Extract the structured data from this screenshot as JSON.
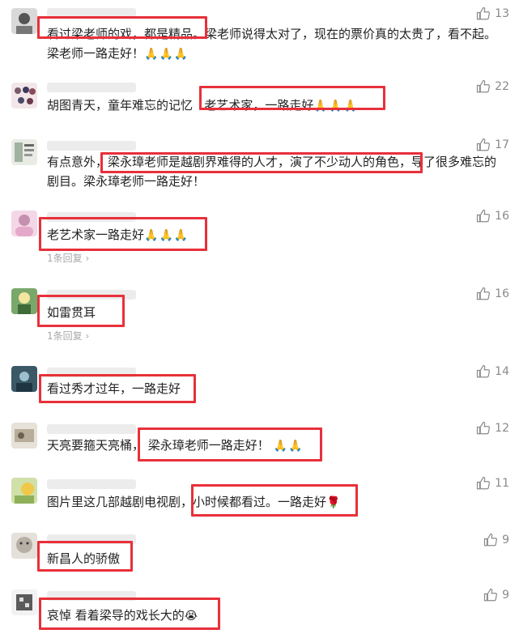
{
  "comments": [
    {
      "likes": "13",
      "text": "看过梁老师的戏，都是精品。梁老师说得太对了，现在的票价真的太贵了，看不起。梁老师一路走好！",
      "emoji": "🙏🙏🙏"
    },
    {
      "likes": "22",
      "text_a": "胡图青天，童年难忘的记忆",
      "text_b": "老艺术家，一路走好",
      "emoji": "🙏🙏🙏"
    },
    {
      "likes": "17",
      "text": "有点意外，梁永璋老师是越剧界难得的人才，演了不少动人的角色，导了很多难忘的剧目。梁永璋老师一路走好！"
    },
    {
      "likes": "16",
      "text": "老艺术家一路走好",
      "emoji": "🙏🙏🙏",
      "reply": "1条回复 ›"
    },
    {
      "likes": "16",
      "text": "如雷贯耳",
      "reply": "1条回复 ›"
    },
    {
      "likes": "14",
      "text": "看过秀才过年，一路走好"
    },
    {
      "likes": "12",
      "text_a": "天亮要箍天亮桶，",
      "text_b": "梁永璋老师一路走好！",
      "emoji": "🙏🙏"
    },
    {
      "likes": "11",
      "text_a": "图片里这几部越剧电视剧，",
      "text_b": "小时候都看过。一路走好",
      "emoji": "🌹"
    },
    {
      "likes": "9",
      "text": "新昌人的骄傲"
    },
    {
      "likes": "9",
      "text": "哀悼  看着梁导的戏长大的",
      "emoji": "😭"
    }
  ],
  "colors": {
    "highlight": "#e8303a",
    "meta": "#8a8a8a"
  },
  "icons": {
    "like": "thumbs-up-icon"
  }
}
